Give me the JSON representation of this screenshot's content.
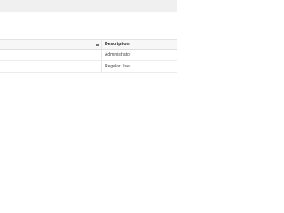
{
  "table": {
    "header": {
      "description_label": "Description",
      "column_menu_icon": "menu-icon"
    },
    "rows": [
      {
        "description": "Administrator"
      },
      {
        "description": "Regular User"
      }
    ]
  },
  "colors": {
    "topbar_border": "#e8a7a7",
    "header_background": "#f7f7f7"
  }
}
